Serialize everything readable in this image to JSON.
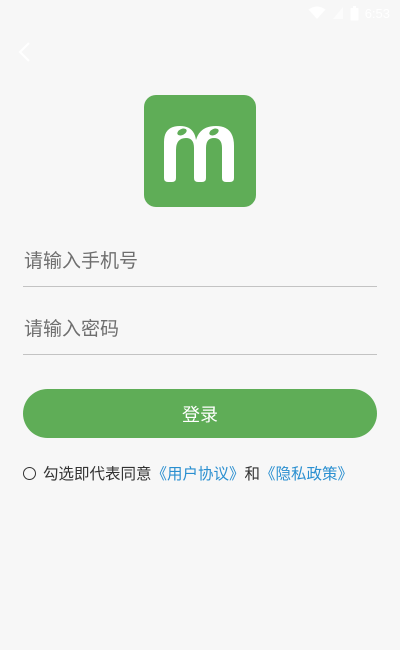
{
  "status_bar": {
    "time": "6:53"
  },
  "icons": {
    "back": "chevron-left-icon",
    "wifi": "wifi-icon",
    "signal": "signal-icon",
    "battery": "battery-icon"
  },
  "colors": {
    "brand_green": "#5fad57",
    "link_blue": "#2a8fd0",
    "background": "#f7f7f7"
  },
  "login": {
    "phone_placeholder": "请输入手机号",
    "password_placeholder": "请输入密码",
    "submit_label": "登录"
  },
  "agreement": {
    "prefix": "勾选即代表同意",
    "user_agreement": "《用户协议》",
    "conjunction": "和",
    "privacy_policy": "《隐私政策》"
  }
}
